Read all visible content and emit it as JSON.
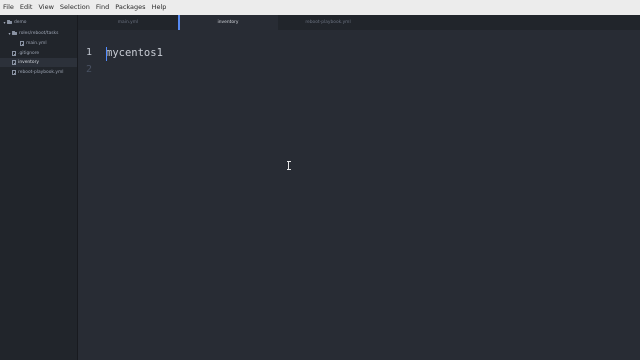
{
  "menubar": {
    "items": [
      {
        "label": "File"
      },
      {
        "label": "Edit"
      },
      {
        "label": "View"
      },
      {
        "label": "Selection"
      },
      {
        "label": "Find"
      },
      {
        "label": "Packages"
      },
      {
        "label": "Help"
      }
    ]
  },
  "tree": {
    "root": "demo",
    "folder": "roles/reboot/tasks",
    "files": [
      "main.yml",
      ".gitignore",
      "inventory",
      "reboot-playbook.yml"
    ]
  },
  "tabs": [
    {
      "label": "main.yml"
    },
    {
      "label": "inventory"
    },
    {
      "label": "reboot-playbook.yml"
    }
  ],
  "editor": {
    "lines": [
      {
        "num": "1",
        "text": "mycentos1"
      },
      {
        "num": "2",
        "text": ""
      }
    ]
  },
  "colors": {
    "accent": "#568af2",
    "editor_bg": "#282c34",
    "sidebar_bg": "#21252b"
  },
  "icons": [
    "folder-icon",
    "file-icon",
    "chevron-down-icon",
    "ibeam-cursor-icon"
  ]
}
